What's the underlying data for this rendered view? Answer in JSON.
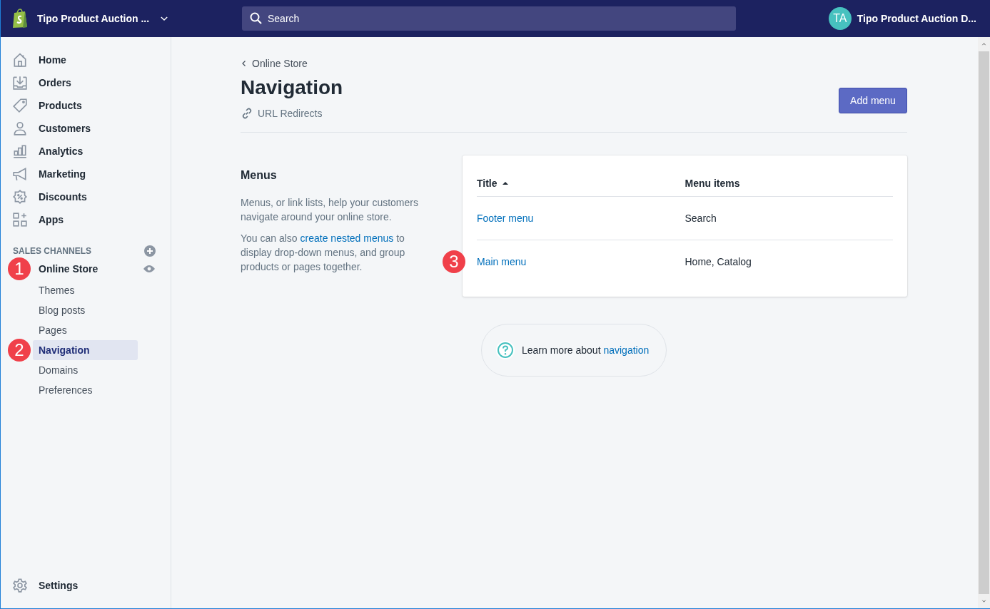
{
  "topbar": {
    "store_name": "Tipo Product Auction ...",
    "search": {
      "placeholder": "Search"
    },
    "avatar_initials": "TA",
    "account_name": "Tipo Product Auction D..."
  },
  "sidebar": {
    "items": [
      {
        "label": "Home"
      },
      {
        "label": "Orders"
      },
      {
        "label": "Products"
      },
      {
        "label": "Customers"
      },
      {
        "label": "Analytics"
      },
      {
        "label": "Marketing"
      },
      {
        "label": "Discounts"
      },
      {
        "label": "Apps"
      }
    ],
    "section_title": "SALES CHANNELS",
    "channel": {
      "label": "Online Store",
      "annotation": "1",
      "children": [
        {
          "label": "Themes",
          "selected": false
        },
        {
          "label": "Blog posts",
          "selected": false
        },
        {
          "label": "Pages",
          "selected": false
        },
        {
          "label": "Navigation",
          "selected": true,
          "annotation": "2"
        },
        {
          "label": "Domains",
          "selected": false
        },
        {
          "label": "Preferences",
          "selected": false
        }
      ]
    },
    "settings": {
      "label": "Settings"
    }
  },
  "header": {
    "breadcrumb": "Online Store",
    "title": "Navigation",
    "secondary_action": "URL Redirects",
    "primary_action": "Add menu"
  },
  "menus_section": {
    "title": "Menus",
    "description": "Menus, or link lists, help your customers navigate around your online store.",
    "nested": {
      "before": "You can also ",
      "link": "create nested menus",
      "after": " to display drop-down menus, and group products or pages together."
    }
  },
  "table": {
    "columns": [
      {
        "label": "Title",
        "sorted": true
      },
      {
        "label": "Menu items",
        "sorted": false
      }
    ],
    "rows": [
      {
        "title": "Footer menu",
        "items": "Search"
      },
      {
        "title": "Main menu",
        "items": "Home, Catalog",
        "annotation": "3"
      }
    ]
  },
  "help": {
    "before": "Learn more about ",
    "link": "navigation"
  }
}
